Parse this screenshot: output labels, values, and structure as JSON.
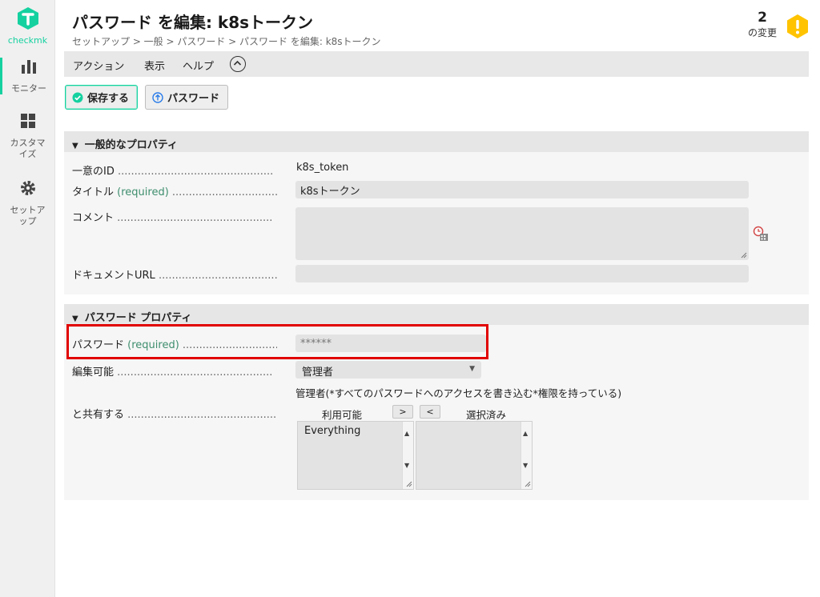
{
  "colors": {
    "accent": "#15d1a0",
    "warning": "#ffc300",
    "highlight": "#e10000",
    "required": "#3e8e6e"
  },
  "sidebar": {
    "logo_text": "checkmk",
    "items": [
      {
        "label": "モニター",
        "icon": "bar-chart-icon"
      },
      {
        "label": "カスタマイズ",
        "icon": "grid-icon"
      },
      {
        "label": "セットアップ",
        "icon": "gear-icon"
      }
    ]
  },
  "header": {
    "title": "パスワード を編集: k8sトークン",
    "breadcrumb": "セットアップ > 一般 > パスワード > パスワード を編集: k8sトークン",
    "changes_count": "2",
    "changes_label": "の変更"
  },
  "menubar": {
    "items": [
      "アクション",
      "表示",
      "ヘルプ"
    ]
  },
  "toolbar": {
    "save_label": "保存する",
    "password_label": "パスワード"
  },
  "general": {
    "heading": "一般的なプロパティ",
    "id_label": "一意のID",
    "id_value": "k8s_token",
    "title_label": "タイトル",
    "required": "(required)",
    "title_value": "k8sトークン",
    "comment_label": "コメント",
    "doc_label": "ドキュメントURL",
    "doc_value": ""
  },
  "password_props": {
    "heading": "パスワード プロパティ",
    "password_label": "パスワード",
    "required": "(required)",
    "password_value": "******",
    "editable_label": "編集可能",
    "editable_value": "管理者",
    "editable_hint": "管理者(*すべてのパスワードへのアクセスを書き込む*権限を持っている)",
    "share_label": "と共有する",
    "available_label": "利用可能",
    "selected_label": "選択済み",
    "add_btn": ">",
    "remove_btn": "<",
    "available_items": [
      "Everything"
    ]
  },
  "dots": "..............................................."
}
